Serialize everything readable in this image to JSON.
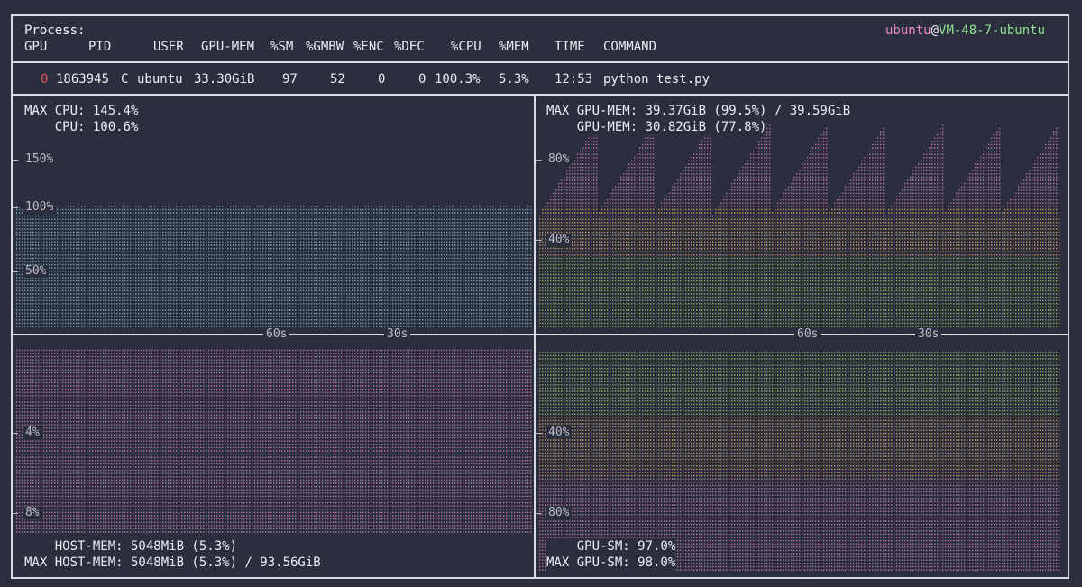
{
  "host": {
    "user": "ubuntu",
    "at": "@",
    "name": "VM-48-7-ubuntu"
  },
  "process_label": "Process:",
  "columns": [
    "GPU",
    "PID",
    "USER",
    "GPU-MEM",
    "%SM",
    "%GMBW",
    "%ENC",
    "%DEC",
    "%CPU",
    "%MEM",
    "TIME",
    "COMMAND"
  ],
  "process_row": {
    "gpu": "0",
    "pid": "1863945",
    "type": "C",
    "user": "ubuntu",
    "gpu_mem": "33.30GiB",
    "sm": "97",
    "gmbw": "52",
    "enc": "0",
    "dec": "0",
    "cpu": "100.3%",
    "mem": "5.3%",
    "time": "12:53",
    "command": "python test.py"
  },
  "panels": {
    "cpu": {
      "max_text": "MAX CPU: 145.4%",
      "cur_text": "    CPU: 100.6%",
      "ticks": [
        "150%",
        "100%",
        "50%"
      ],
      "color": "#8fc3e6"
    },
    "gpu_mem": {
      "max_text": "MAX GPU-MEM: 39.37GiB (99.5%) / 39.59GiB",
      "cur_text": "    GPU-MEM: 30.82GiB (77.8%)",
      "ticks": [
        "80%",
        "40%"
      ],
      "color_top": "#e88ac0",
      "color_mid": "#f2b56b",
      "color_low": "#a7d86a"
    },
    "time_axis": {
      "left": [
        "60s",
        "30s"
      ],
      "right": [
        "60s",
        "30s"
      ]
    },
    "host_mem": {
      "ticks": [
        "4%",
        "8%"
      ],
      "cur_text": "    HOST-MEM: 5048MiB (5.3%)",
      "max_text": "MAX HOST-MEM: 5048MiB (5.3%) / 93.56GiB",
      "color": "#e88ac0"
    },
    "gpu_sm": {
      "ticks": [
        "40%",
        "80%"
      ],
      "cur_text": "    GPU-SM: 97.0%",
      "max_text": "MAX GPU-SM: 98.0%",
      "color_top": "#a7d86a",
      "color_mid": "#f2b56b",
      "color_low": "#e88ac0"
    }
  }
}
